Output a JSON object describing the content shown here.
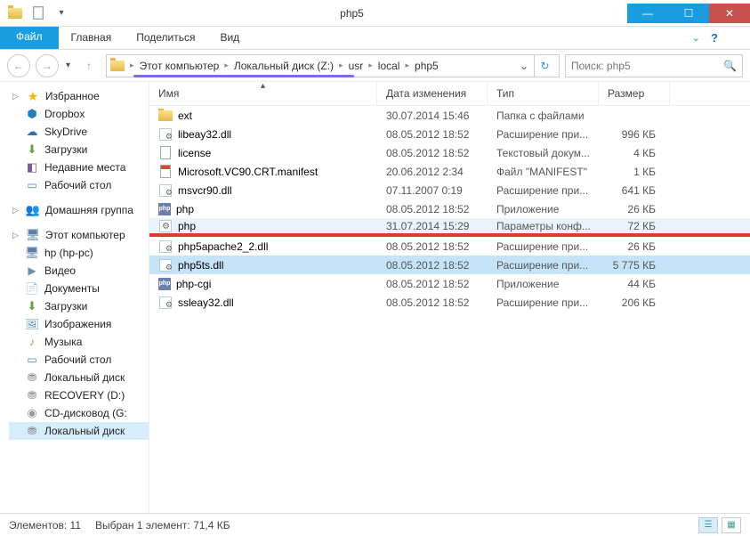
{
  "window": {
    "title": "php5"
  },
  "tabs": {
    "file": "Файл",
    "home": "Главная",
    "share": "Поделиться",
    "view": "Вид"
  },
  "breadcrumb": {
    "segments": [
      "Этот компьютер",
      "Локальный диск (Z:)",
      "usr",
      "local",
      "php5"
    ]
  },
  "search": {
    "placeholder": "Поиск: php5"
  },
  "columns": {
    "name": "Имя",
    "date": "Дата изменения",
    "type": "Тип",
    "size": "Размер"
  },
  "sidebar": {
    "favorites_label": "Избранное",
    "favorites": [
      {
        "label": "Dropbox",
        "icon": "dropbox"
      },
      {
        "label": "SkyDrive",
        "icon": "skydrive"
      },
      {
        "label": "Загрузки",
        "icon": "download"
      },
      {
        "label": "Недавние места",
        "icon": "recent"
      },
      {
        "label": "Рабочий стол",
        "icon": "desktop"
      }
    ],
    "homegroup_label": "Домашняя группа",
    "pc_label": "Этот компьютер",
    "pc": [
      {
        "label": "hp (hp-pc)",
        "icon": "pc"
      },
      {
        "label": "Видео",
        "icon": "video"
      },
      {
        "label": "Документы",
        "icon": "doc"
      },
      {
        "label": "Загрузки",
        "icon": "download"
      },
      {
        "label": "Изображения",
        "icon": "pic"
      },
      {
        "label": "Музыка",
        "icon": "music"
      },
      {
        "label": "Рабочий стол",
        "icon": "desktop"
      },
      {
        "label": "Локальный диск",
        "icon": "drive"
      },
      {
        "label": "RECOVERY (D:)",
        "icon": "drive"
      },
      {
        "label": "CD-дисковод (G:",
        "icon": "cd"
      },
      {
        "label": "Локальный диск",
        "icon": "drive",
        "selected": true
      }
    ]
  },
  "files": [
    {
      "name": "ext",
      "date": "30.07.2014 15:46",
      "type": "Папка с файлами",
      "size": "",
      "icon": "folder"
    },
    {
      "name": "libeay32.dll",
      "date": "08.05.2012 18:52",
      "type": "Расширение при...",
      "size": "996 КБ",
      "icon": "dll"
    },
    {
      "name": "license",
      "date": "08.05.2012 18:52",
      "type": "Текстовый докум...",
      "size": "4 КБ",
      "icon": "txt"
    },
    {
      "name": "Microsoft.VC90.CRT.manifest",
      "date": "20.06.2012 2:34",
      "type": "Файл \"MANIFEST\"",
      "size": "1 КБ",
      "icon": "mf"
    },
    {
      "name": "msvcr90.dll",
      "date": "07.11.2007 0:19",
      "type": "Расширение при...",
      "size": "641 КБ",
      "icon": "dll"
    },
    {
      "name": "php",
      "date": "08.05.2012 18:52",
      "type": "Приложение",
      "size": "26 КБ",
      "icon": "php"
    },
    {
      "name": "php",
      "date": "31.07.2014 15:29",
      "type": "Параметры конф...",
      "size": "72 КБ",
      "icon": "ini",
      "highlighted": true,
      "red_underline": true
    },
    {
      "name": "php5apache2_2.dll",
      "date": "08.05.2012 18:52",
      "type": "Расширение при...",
      "size": "26 КБ",
      "icon": "dll"
    },
    {
      "name": "php5ts.dll",
      "date": "08.05.2012 18:52",
      "type": "Расширение при...",
      "size": "5 775 КБ",
      "icon": "dll",
      "selected": true
    },
    {
      "name": "php-cgi",
      "date": "08.05.2012 18:52",
      "type": "Приложение",
      "size": "44 КБ",
      "icon": "php"
    },
    {
      "name": "ssleay32.dll",
      "date": "08.05.2012 18:52",
      "type": "Расширение при...",
      "size": "206 КБ",
      "icon": "dll"
    }
  ],
  "status": {
    "count": "Элементов: 11",
    "selection": "Выбран 1 элемент: 71,4 КБ"
  }
}
